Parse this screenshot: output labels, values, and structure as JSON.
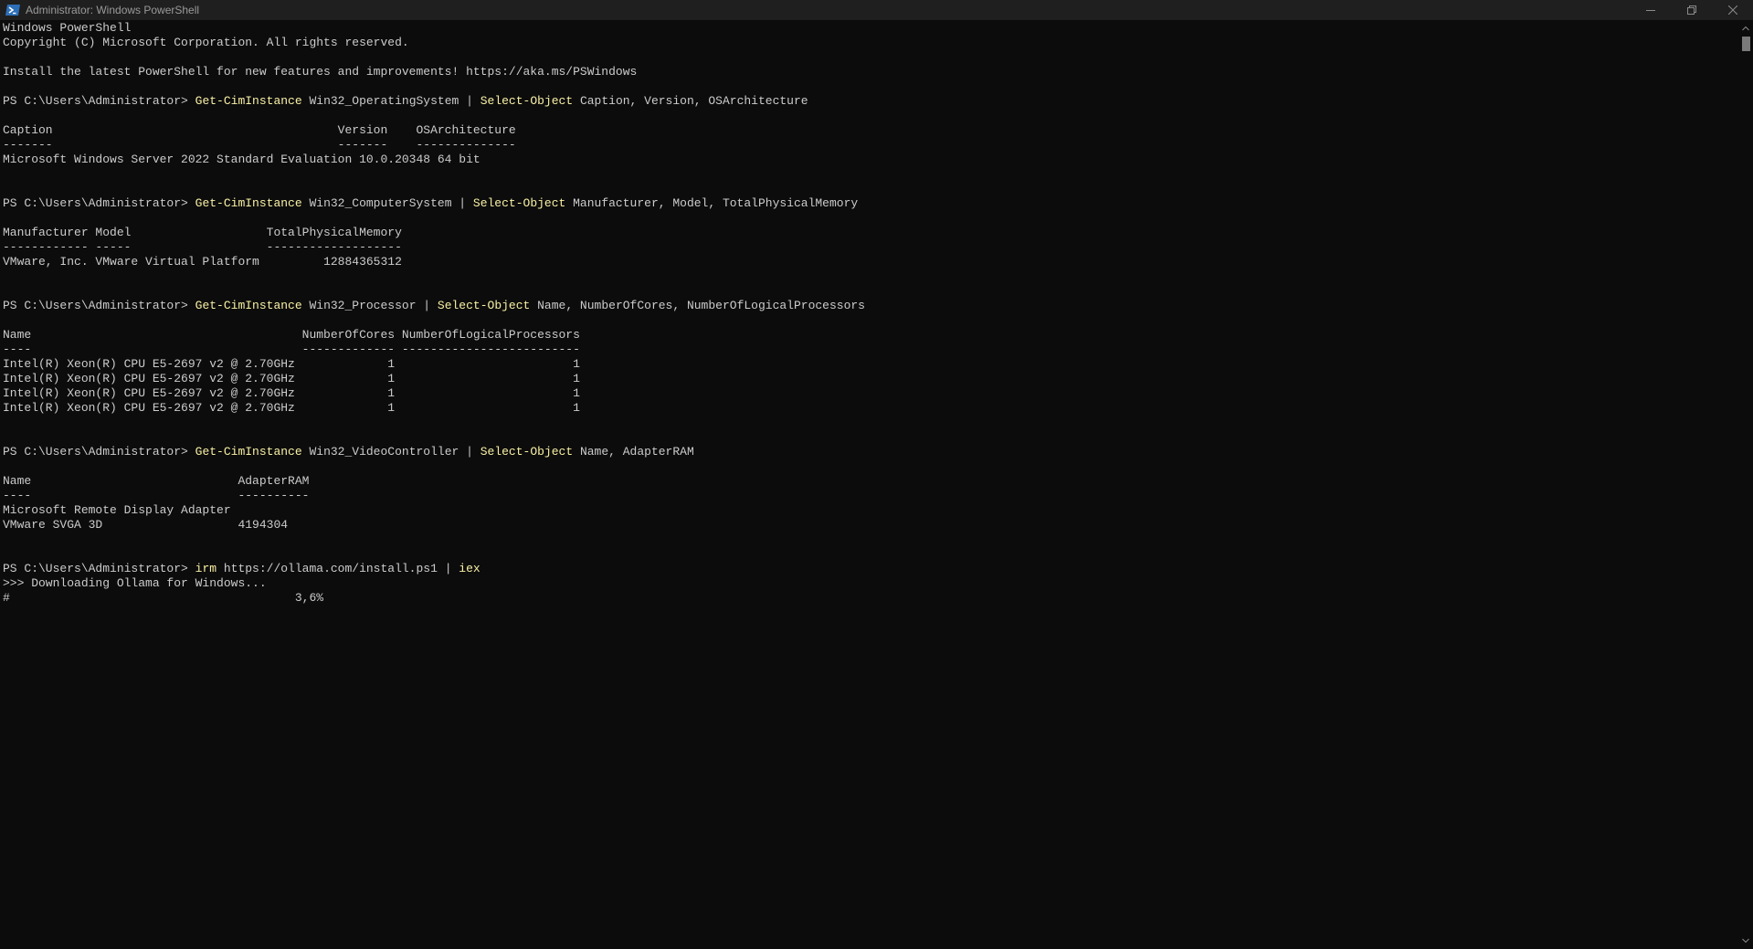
{
  "window": {
    "title": "Administrator: Windows PowerShell",
    "icon": "powershell-icon"
  },
  "colors": {
    "background": "#0c0c0c",
    "text": "#cccccc",
    "command": "#f9f1a5",
    "titlebar": "#1f1f1f"
  },
  "console": {
    "lines": [
      [
        {
          "t": "Windows PowerShell"
        }
      ],
      [
        {
          "t": "Copyright (C) Microsoft Corporation. All rights reserved."
        }
      ],
      [
        {
          "t": ""
        }
      ],
      [
        {
          "t": "Install the latest PowerShell for new features and improvements! https://aka.ms/PSWindows"
        }
      ],
      [
        {
          "t": ""
        }
      ],
      [
        {
          "t": "PS C:\\Users\\Administrator> "
        },
        {
          "t": "Get-CimInstance",
          "c": "cmd"
        },
        {
          "t": " Win32_OperatingSystem | "
        },
        {
          "t": "Select-Object",
          "c": "cmd"
        },
        {
          "t": " Caption, Version, OSArchitecture"
        }
      ],
      [
        {
          "t": ""
        }
      ],
      [
        {
          "t": "Caption                                        Version    OSArchitecture"
        }
      ],
      [
        {
          "t": "-------                                        -------    --------------"
        }
      ],
      [
        {
          "t": "Microsoft Windows Server 2022 Standard Evaluation 10.0.20348 64 bit"
        }
      ],
      [
        {
          "t": ""
        }
      ],
      [
        {
          "t": ""
        }
      ],
      [
        {
          "t": "PS C:\\Users\\Administrator> "
        },
        {
          "t": "Get-CimInstance",
          "c": "cmd"
        },
        {
          "t": " Win32_ComputerSystem | "
        },
        {
          "t": "Select-Object",
          "c": "cmd"
        },
        {
          "t": " Manufacturer, Model, TotalPhysicalMemory"
        }
      ],
      [
        {
          "t": ""
        }
      ],
      [
        {
          "t": "Manufacturer Model                   TotalPhysicalMemory"
        }
      ],
      [
        {
          "t": "------------ -----                   -------------------"
        }
      ],
      [
        {
          "t": "VMware, Inc. VMware Virtual Platform         12884365312"
        }
      ],
      [
        {
          "t": ""
        }
      ],
      [
        {
          "t": ""
        }
      ],
      [
        {
          "t": "PS C:\\Users\\Administrator> "
        },
        {
          "t": "Get-CimInstance",
          "c": "cmd"
        },
        {
          "t": " Win32_Processor | "
        },
        {
          "t": "Select-Object",
          "c": "cmd"
        },
        {
          "t": " Name, NumberOfCores, NumberOfLogicalProcessors"
        }
      ],
      [
        {
          "t": ""
        }
      ],
      [
        {
          "t": "Name                                      NumberOfCores NumberOfLogicalProcessors"
        }
      ],
      [
        {
          "t": "----                                      ------------- -------------------------"
        }
      ],
      [
        {
          "t": "Intel(R) Xeon(R) CPU E5-2697 v2 @ 2.70GHz             1                         1"
        }
      ],
      [
        {
          "t": "Intel(R) Xeon(R) CPU E5-2697 v2 @ 2.70GHz             1                         1"
        }
      ],
      [
        {
          "t": "Intel(R) Xeon(R) CPU E5-2697 v2 @ 2.70GHz             1                         1"
        }
      ],
      [
        {
          "t": "Intel(R) Xeon(R) CPU E5-2697 v2 @ 2.70GHz             1                         1"
        }
      ],
      [
        {
          "t": ""
        }
      ],
      [
        {
          "t": ""
        }
      ],
      [
        {
          "t": "PS C:\\Users\\Administrator> "
        },
        {
          "t": "Get-CimInstance",
          "c": "cmd"
        },
        {
          "t": " Win32_VideoController | "
        },
        {
          "t": "Select-Object",
          "c": "cmd"
        },
        {
          "t": " Name, AdapterRAM"
        }
      ],
      [
        {
          "t": ""
        }
      ],
      [
        {
          "t": "Name                             AdapterRAM"
        }
      ],
      [
        {
          "t": "----                             ----------"
        }
      ],
      [
        {
          "t": "Microsoft Remote Display Adapter"
        }
      ],
      [
        {
          "t": "VMware SVGA 3D                   4194304"
        }
      ],
      [
        {
          "t": ""
        }
      ],
      [
        {
          "t": ""
        }
      ],
      [
        {
          "t": "PS C:\\Users\\Administrator> "
        },
        {
          "t": "irm",
          "c": "cmd"
        },
        {
          "t": " https://ollama.com/install.ps1 | "
        },
        {
          "t": "iex",
          "c": "cmd"
        }
      ],
      [
        {
          "t": ">>> Downloading Ollama for Windows..."
        }
      ],
      [
        {
          "t": "#                                        3,6%"
        }
      ]
    ]
  },
  "progress": {
    "percent_text": "3,6%",
    "fraction": 0.036
  }
}
